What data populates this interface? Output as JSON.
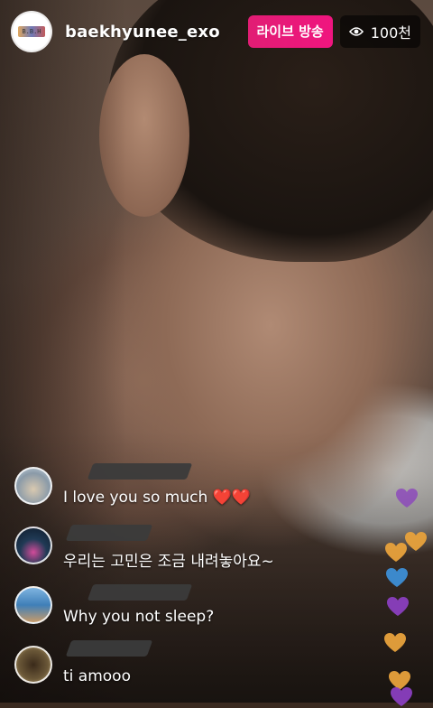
{
  "header": {
    "username": "baekhyunee_exo",
    "avatar_text": "B.B.H",
    "live_label": "라이브 방송",
    "viewer_count": "100천"
  },
  "comments": [
    {
      "name": "",
      "text": "I love you so much ❤️❤️"
    },
    {
      "name": "",
      "text": "우리는 고민은 조금 내려놓아요~"
    },
    {
      "name": "",
      "text": "Why you not sleep?"
    },
    {
      "name": "",
      "text": "ti amooo"
    }
  ],
  "colors": {
    "live_badge": "#e8197a",
    "hearts": [
      "#8a3fbf",
      "#e8a23c",
      "#e8a23c",
      "#3d8fd6",
      "#8a3fbf",
      "#e8a23c",
      "#e8a23c",
      "#8a3fbf"
    ]
  }
}
